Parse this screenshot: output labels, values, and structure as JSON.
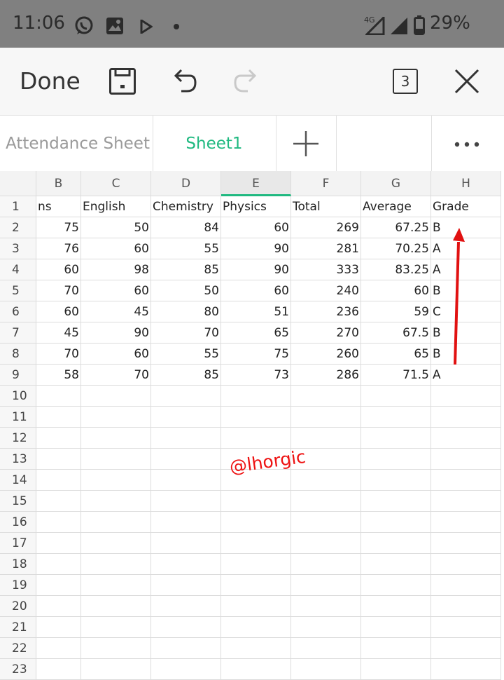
{
  "status_bar": {
    "time": "11:06",
    "network": "4G",
    "battery": "29%"
  },
  "toolbar": {
    "done_label": "Done",
    "tabs_count": "3"
  },
  "sheet_tabs": [
    {
      "label": "Attendance Sheet",
      "active": false
    },
    {
      "label": "Sheet1",
      "active": true
    }
  ],
  "columns": [
    "B",
    "C",
    "D",
    "E",
    "F",
    "G",
    "H"
  ],
  "selected_column": "E",
  "rows": [
    [
      "ns",
      "English",
      "Chemistry",
      "Physics",
      "Total",
      "Average",
      "Grade"
    ],
    [
      "75",
      "50",
      "84",
      "60",
      "269",
      "67.25",
      "B"
    ],
    [
      "76",
      "60",
      "55",
      "90",
      "281",
      "70.25",
      "A"
    ],
    [
      "60",
      "98",
      "85",
      "90",
      "333",
      "83.25",
      "A"
    ],
    [
      "70",
      "60",
      "50",
      "60",
      "240",
      "60",
      "B"
    ],
    [
      "60",
      "45",
      "80",
      "51",
      "236",
      "59",
      "C"
    ],
    [
      "45",
      "90",
      "70",
      "65",
      "270",
      "67.5",
      "B"
    ],
    [
      "70",
      "60",
      "55",
      "75",
      "260",
      "65",
      "B"
    ],
    [
      "58",
      "70",
      "85",
      "73",
      "286",
      "71.5",
      "A"
    ]
  ],
  "row_numbers": [
    "1",
    "2",
    "3",
    "4",
    "5",
    "6",
    "7",
    "8",
    "9",
    "10",
    "11",
    "12",
    "13",
    "14",
    "15",
    "16",
    "17",
    "18",
    "19",
    "20",
    "21",
    "22",
    "23"
  ],
  "watermark": "@lhorgic",
  "colors": {
    "accent": "#1fb980",
    "annotation": "#e11111",
    "statusbar": "#808080"
  }
}
